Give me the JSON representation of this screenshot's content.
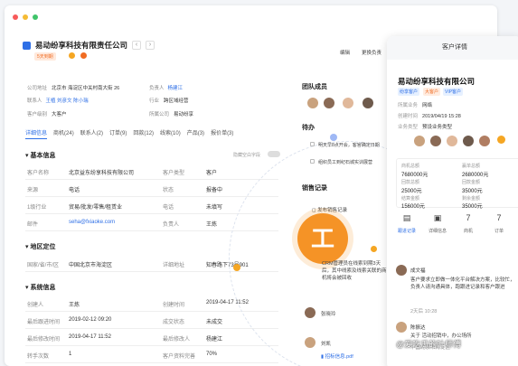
{
  "company": {
    "name": "易动纷享科技有限责任公司",
    "tag": "5天到期"
  },
  "top_buttons": [
    "编辑",
    "更换负责"
  ],
  "meta": [
    {
      "k": "公司地址",
      "v": "北京市 海淀区中关村南大街 26",
      "k2": "负责人",
      "v2": "杨建江"
    },
    {
      "k": "联系人",
      "v": "王植 刘彦文 陈小瑞",
      "k2": "行业",
      "v2": "跨区域经营"
    },
    {
      "k": "客户级别",
      "v": "大客户",
      "k2": "所属公司",
      "v2": "易动纷享"
    }
  ],
  "tabs": [
    "详细信息",
    "商机(24)",
    "联系人(2)",
    "订单(9)",
    "回款(12)",
    "线索(10)",
    "产品(3)",
    "报价单(3)"
  ],
  "sections": {
    "basic": "基本信息",
    "region": "地区定位",
    "system": "系统信息",
    "hide": "隐藏空白字段"
  },
  "basic_rows": [
    {
      "k": "客户名称",
      "v": "北京益东纷享科技有限公司",
      "k2": "客户类型",
      "v2": "客户"
    },
    {
      "k": "来源",
      "v": "电话",
      "k2": "状态",
      "v2": "报备中"
    },
    {
      "k": "1级行业",
      "v": "贸易/批发/零售/租赁业",
      "k2": "电话",
      "v2": "未填写"
    },
    {
      "k": "邮件",
      "v": "seha@fxiaoke.com",
      "k2": "负责人",
      "v2": "王炼"
    }
  ],
  "region_rows": [
    {
      "k": "国家/省/市/区",
      "v": "中国北京市海淀区",
      "k2": "详细地址",
      "v2": "知春路下73号901"
    }
  ],
  "system_rows": [
    {
      "k": "创建人",
      "v": "王炼",
      "k2": "创建时间",
      "v2": "2019-04-17 11:52"
    },
    {
      "k": "最后跟进时间",
      "v": "2019-02-12 09:20",
      "k2": "成交状态",
      "v2": "未成交"
    },
    {
      "k": "最后修改时间",
      "v": "2019-04-17 11:52",
      "k2": "最后修改人",
      "v2": "杨建江"
    },
    {
      "k": "转手次数",
      "v": "1",
      "k2": "客户资料完善",
      "v2": "70%"
    }
  ],
  "middle": {
    "team": "团队成员",
    "todo": "待办",
    "todos": [
      "明天早8点开会，客官确定日期",
      "组织员工到纪石城实训展营"
    ],
    "records": "销售记录",
    "rec1": "发布销售记录",
    "bubble": "CRM管理员在线索到期3天后，其中线索及线索关联的商机将会被回收",
    "r1": "张晓玲",
    "r2": "刘凯",
    "file": "招标信息.pdf",
    "big_char": "工"
  },
  "card": {
    "header": "客户详情",
    "name": "易动纷享科技有限公司",
    "tags": [
      "纷享客户",
      "大客户",
      "VIP客户"
    ],
    "kv": [
      {
        "k": "所属业务",
        "v": "网络"
      },
      {
        "k": "创建时间",
        "v": "2019/04/19 15:28"
      },
      {
        "k": "业务类型",
        "v": "预设业务类型"
      }
    ],
    "grid": [
      {
        "k": "商机总额",
        "v": "7680000元"
      },
      {
        "k": "赢单总额",
        "v": "2680000元"
      },
      {
        "k": "回款总额",
        "v": "25000元"
      },
      {
        "k": "回款金额",
        "v": "35000元"
      },
      {
        "k": "结算金额",
        "v": "156000元"
      },
      {
        "k": "剩余金额",
        "v": "35000元"
      }
    ],
    "func": [
      {
        "icon": "▤",
        "l": "跟进记录"
      },
      {
        "icon": "▣",
        "l": "详细信息"
      },
      {
        "icon": "7",
        "l": "商机"
      },
      {
        "icon": "7",
        "l": "订单"
      }
    ],
    "c1n": "成文福",
    "c1t": "客户要求立即做一体化平台解决方案，比较忙，负责人请沟通具体，跑跟进记录和客户跟进",
    "c1tm": "2天后 10:28",
    "c2n": "陈振达",
    "c2t": "关于 活动招销中，办公场所",
    "c2tm": "中国北京市海淀区"
  },
  "watermark": "@爱吃瓜的叶师傅"
}
